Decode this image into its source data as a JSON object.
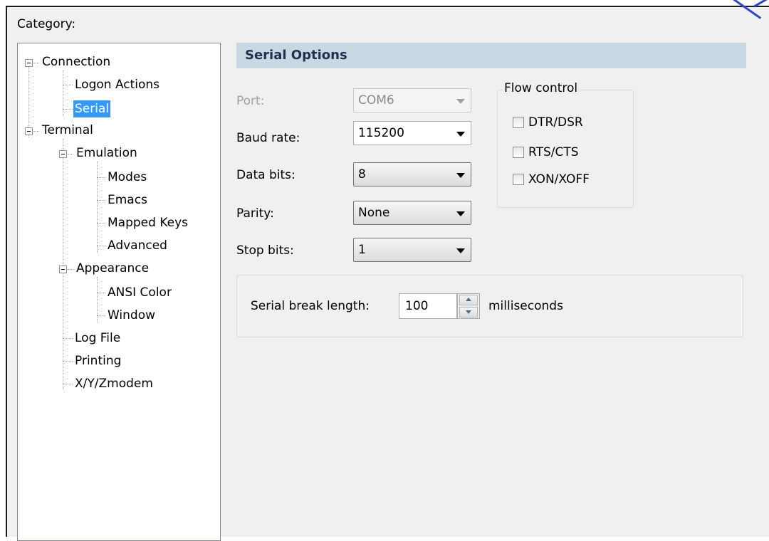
{
  "category_label": "Category:",
  "tree": {
    "connection": "Connection",
    "logon_actions": "Logon Actions",
    "serial": "Serial",
    "terminal": "Terminal",
    "emulation": "Emulation",
    "modes": "Modes",
    "emacs": "Emacs",
    "mapped_keys": "Mapped Keys",
    "advanced": "Advanced",
    "appearance": "Appearance",
    "ansi_color": "ANSI Color",
    "window": "Window",
    "log_file": "Log File",
    "printing": "Printing",
    "xyzmodem": "X/Y/Zmodem"
  },
  "section_title": "Serial Options",
  "fields": {
    "port_label": "Port:",
    "port_value": "COM6",
    "baud_label": "Baud rate:",
    "baud_value": "115200",
    "databits_label": "Data bits:",
    "databits_value": "8",
    "parity_label": "Parity:",
    "parity_value": "None",
    "stopbits_label": "Stop bits:",
    "stopbits_value": "1"
  },
  "flow_control": {
    "title": "Flow control",
    "dtr_dsr": "DTR/DSR",
    "rts_cts": "RTS/CTS",
    "xon_xoff": "XON/XOFF"
  },
  "serial_break": {
    "label": "Serial break length:",
    "value": "100",
    "units": "milliseconds"
  }
}
